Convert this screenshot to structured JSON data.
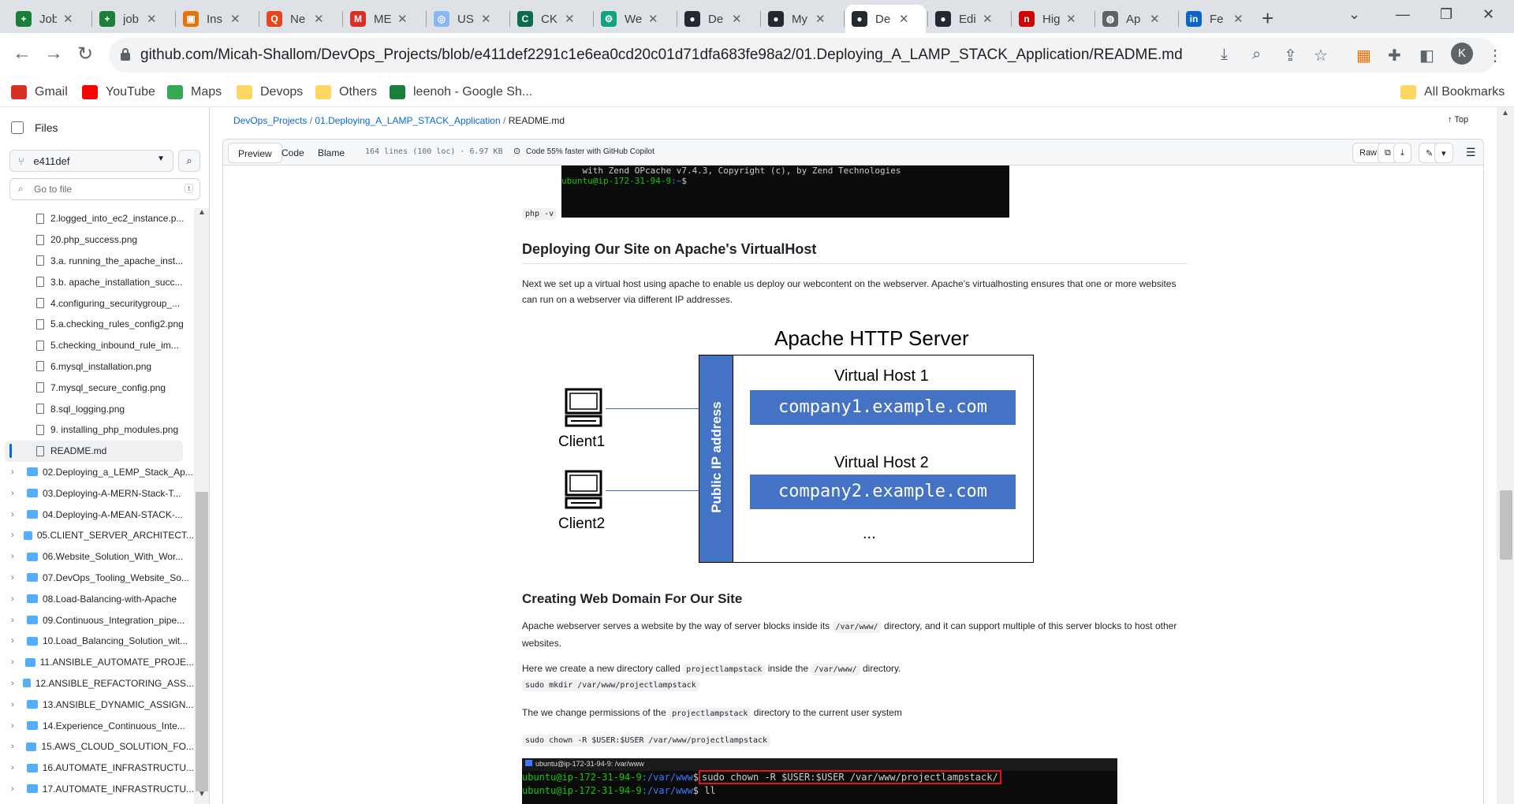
{
  "browser": {
    "tabs": [
      {
        "label": "Job",
        "icon_color": "#188038",
        "icon_glyph": "+"
      },
      {
        "label": "job",
        "icon_color": "#188038",
        "icon_glyph": "+"
      },
      {
        "label": "Ins",
        "icon_color": "#e8710a",
        "icon_glyph": "▣"
      },
      {
        "label": "Ne",
        "icon_color": "#e8461e",
        "icon_glyph": "Q"
      },
      {
        "label": "ME",
        "icon_color": "#d93025",
        "icon_glyph": "M"
      },
      {
        "label": "USI",
        "icon_color": "#8ab4f8",
        "icon_glyph": "◎"
      },
      {
        "label": "CK",
        "icon_color": "#0d6b4d",
        "icon_glyph": "C"
      },
      {
        "label": "We",
        "icon_color": "#10a37f",
        "icon_glyph": "⚙"
      },
      {
        "label": "De",
        "icon_color": "#24292f",
        "icon_glyph": "●"
      },
      {
        "label": "My",
        "icon_color": "#24292f",
        "icon_glyph": "●"
      },
      {
        "label": "De",
        "icon_color": "#24292f",
        "icon_glyph": "●"
      },
      {
        "label": "Edi",
        "icon_color": "#24292f",
        "icon_glyph": "●"
      },
      {
        "label": "Hig",
        "icon_color": "#d00000",
        "icon_glyph": "n"
      },
      {
        "label": "Ap",
        "icon_color": "#5f6368",
        "icon_glyph": "◍"
      },
      {
        "label": "Fe",
        "icon_color": "#0a66c2",
        "icon_glyph": "in"
      }
    ],
    "url": "github.com/Micah-Shallom/DevOps_Projects/blob/e411def2291c1e6ea0cd20c01d71dfa683fe98a2/01.Deploying_A_LAMP_STACK_Application/README.md",
    "profile_initial": "K",
    "bookmarks": [
      {
        "label": "Gmail",
        "icon_color": "#d93025"
      },
      {
        "label": "YouTube",
        "icon_color": "#ff0000"
      },
      {
        "label": "Maps",
        "icon_color": "#34a853"
      },
      {
        "label": "Devops",
        "icon_color": "#fdd663"
      },
      {
        "label": "Others",
        "icon_color": "#fdd663"
      },
      {
        "label": "leenoh - Google Sh...",
        "icon_color": "#188038"
      }
    ],
    "all_bookmarks": "All Bookmarks"
  },
  "sidebar": {
    "title": "Files",
    "branch": "e411def",
    "goto_placeholder": "Go to file",
    "goto_shortcut": "t",
    "files": [
      "2.logged_into_ec2_instance.p...",
      "20.php_success.png",
      "3.a. running_the_apache_inst...",
      "3.b. apache_installation_succ...",
      "4.configuring_securitygroup_...",
      "5.a.checking_rules_config2.png",
      "5.checking_inbound_rule_im...",
      "6.mysql_installation.png",
      "7.mysql_secure_config.png",
      "8.sql_logging.png",
      "9. installing_php_modules.png"
    ],
    "selected_file": "README.md",
    "folders": [
      "02.Deploying_a_LEMP_Stack_Ap...",
      "03.Deploying-A-MERN-Stack-T...",
      "04.Deploying-A-MEAN-STACK-...",
      "05.CLIENT_SERVER_ARCHITECT...",
      "06.Website_Solution_With_Wor...",
      "07.DevOps_Tooling_Website_So...",
      "08.Load-Balancing-with-Apache",
      "09.Continuous_Integration_pipe...",
      "10.Load_Balancing_Solution_wit...",
      "11.ANSIBLE_AUTOMATE_PROJE...",
      "12.ANSIBLE_REFACTORING_ASS...",
      "13.ANSIBLE_DYNAMIC_ASSIGN...",
      "14.Experience_Continuous_Inte...",
      "15.AWS_CLOUD_SOLUTION_FO...",
      "16.AUTOMATE_INFRASTRUCTU...",
      "17.AUTOMATE_INFRASTRUCTU..."
    ]
  },
  "header": {
    "breadcrumb": {
      "repo": "DevOps_Projects",
      "folder": "01.Deploying_A_LAMP_STACK_Application",
      "file": "README.md",
      "sep": "/"
    },
    "top_link": "Top",
    "tabs": {
      "preview": "Preview",
      "code": "Code",
      "blame": "Blame"
    },
    "file_info": "164 lines (100 loc) · 6.97 KB",
    "copilot": "Code 55% faster with GitHub Copilot",
    "raw": "Raw"
  },
  "content": {
    "term1": {
      "line1": "    with Zend OPcache v7.4.3, Copyright (c), by Zend Technologies",
      "prompt": "ubuntu@ip-172-31-94-9",
      "path": ":~",
      "suffix": "$"
    },
    "php_v": "php -v",
    "section1_title": "Deploying Our Site on Apache's VirtualHost",
    "section1_para": "Next we set up a virtual host using apache to enable us deploy our webcontent on the webserver. Apache's virtualhosting ensures that one or more websites can run on a webserver via different IP addresses.",
    "diagram": {
      "title": "Apache HTTP Server",
      "band_label": "Public IP address",
      "vhost1_title": "Virtual Host 1",
      "vhost1_domain": "company1.example.com",
      "vhost2_title": "Virtual Host 2",
      "vhost2_domain": "company2.example.com",
      "ellipsis": "...",
      "client1": "Client1",
      "client2": "Client2"
    },
    "section2_title": "Creating Web Domain For Our Site",
    "p2_before": "Apache webserver serves a website by the way of server blocks inside its ",
    "p2_code": "/var/www/",
    "p2_after": " directory, and it can support multiple of this server blocks to host other websites.",
    "p3_before": "Here we create a new directory called ",
    "p3_code1": "projectlampstack",
    "p3_mid": " inside the ",
    "p3_code2": "/var/www/",
    "p3_after": " directory.",
    "mkdir_cmd": "sudo mkdir /var/www/projectlampstack",
    "p4_before": "The we change permissions of the ",
    "p4_code": "projectlampstack",
    "p4_after": " directory to the current user system",
    "chown_cmd": "sudo chown -R $USER:$USER /var/www/projectlampstack",
    "term2": {
      "title": "ubuntu@ip-172-31-94-9: /var/www",
      "prompt": "ubuntu@ip-172-31-94-9",
      "path": ":/var/www",
      "suffix": "$",
      "cmd1": "sudo chown -R $USER:$USER /var/www/projectlampstack/",
      "cmd2": " ll"
    }
  }
}
